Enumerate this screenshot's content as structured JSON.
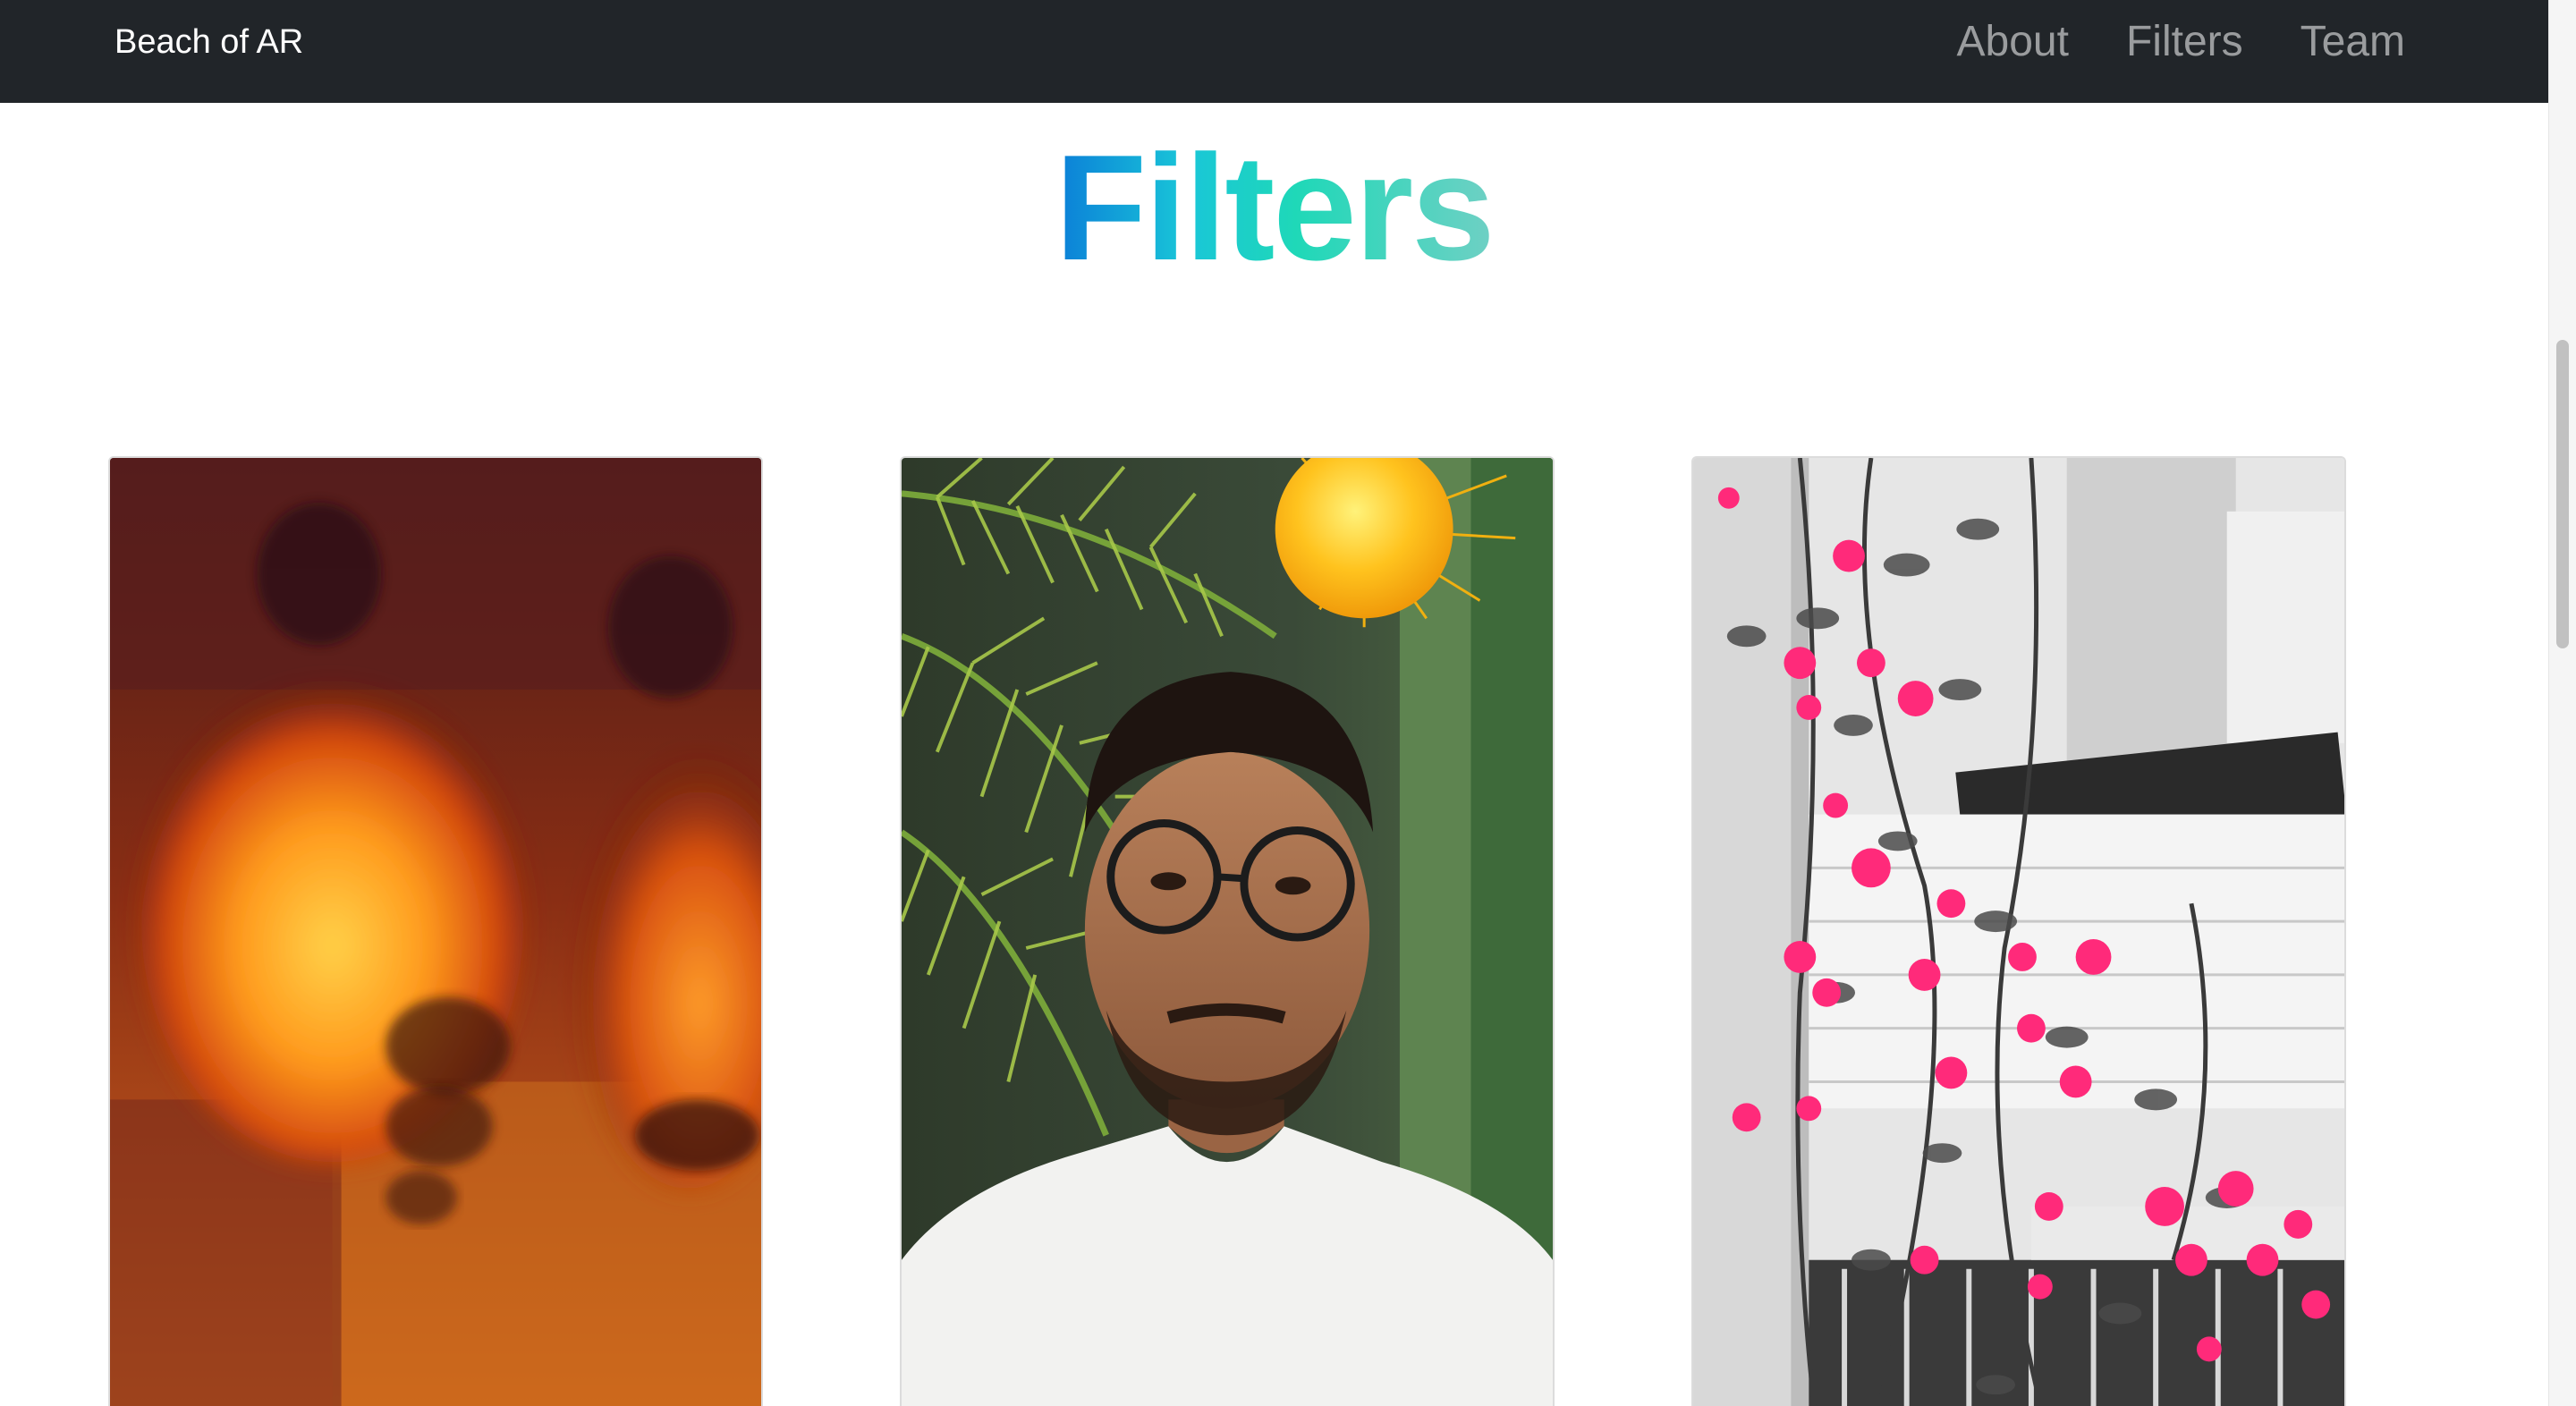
{
  "navbar": {
    "brand": "Beach of AR",
    "links": [
      "About",
      "Filters",
      "Team"
    ],
    "background": "#212529"
  },
  "main": {
    "heading": "Filters",
    "cards": [
      {
        "image": "warm-lamps-filter-preview"
      },
      {
        "image": "beach-palm-sun-filter-preview"
      },
      {
        "image": "pink-flowers-colour-pop-filter-preview"
      }
    ]
  },
  "colors": {
    "heading_gradient": [
      "#0b7ed8",
      "#19c6d8",
      "#1fd8b8",
      "#6fd0c4"
    ]
  }
}
